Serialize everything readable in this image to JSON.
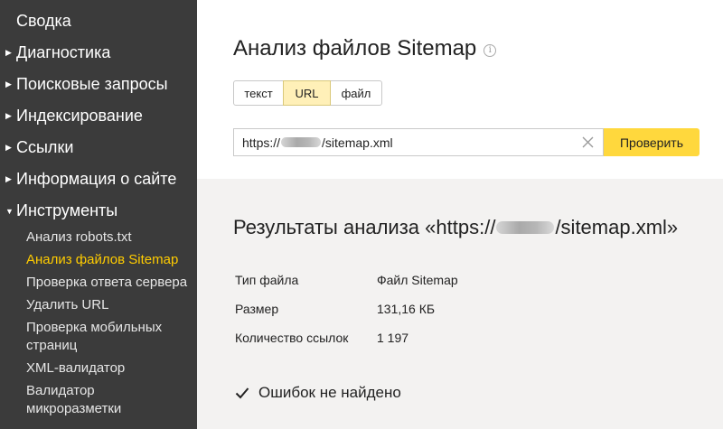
{
  "sidebar": {
    "top_item": "Сводка",
    "sections": [
      {
        "label": "Диагностика",
        "expanded": false
      },
      {
        "label": "Поисковые запросы",
        "expanded": false
      },
      {
        "label": "Индексирование",
        "expanded": false
      },
      {
        "label": "Ссылки",
        "expanded": false
      },
      {
        "label": "Информация о сайте",
        "expanded": false
      },
      {
        "label": "Инструменты",
        "expanded": true
      }
    ],
    "tools_items": [
      {
        "label": "Анализ robots.txt",
        "active": false
      },
      {
        "label": "Анализ файлов Sitemap",
        "active": true
      },
      {
        "label": "Проверка ответа сервера",
        "active": false
      },
      {
        "label": "Удалить URL",
        "active": false
      },
      {
        "label": "Проверка мобильных страниц",
        "active": false
      },
      {
        "label": "XML-валидатор",
        "active": false
      },
      {
        "label": "Валидатор микроразметки",
        "active": false
      }
    ],
    "active_color": "#ffcc00",
    "background": "#3b3b3b"
  },
  "main": {
    "title": "Анализ файлов Sitemap",
    "tabs": [
      {
        "label": "текст",
        "selected": false
      },
      {
        "label": "URL",
        "selected": true
      },
      {
        "label": "файл",
        "selected": false
      }
    ],
    "url_input": {
      "prefix": "https://",
      "suffix": "/sitemap.xml"
    },
    "check_button": "Проверить",
    "check_button_color": "#ffd83d"
  },
  "results": {
    "title_prefix": "Результаты анализа «https://",
    "title_suffix": "/sitemap.xml»",
    "rows": [
      {
        "key": "Тип файла",
        "value": "Файл Sitemap"
      },
      {
        "key": "Размер",
        "value": "131,16 КБ"
      },
      {
        "key": "Количество ссылок",
        "value": "1 197"
      }
    ],
    "status": "Ошибок не найдено"
  }
}
